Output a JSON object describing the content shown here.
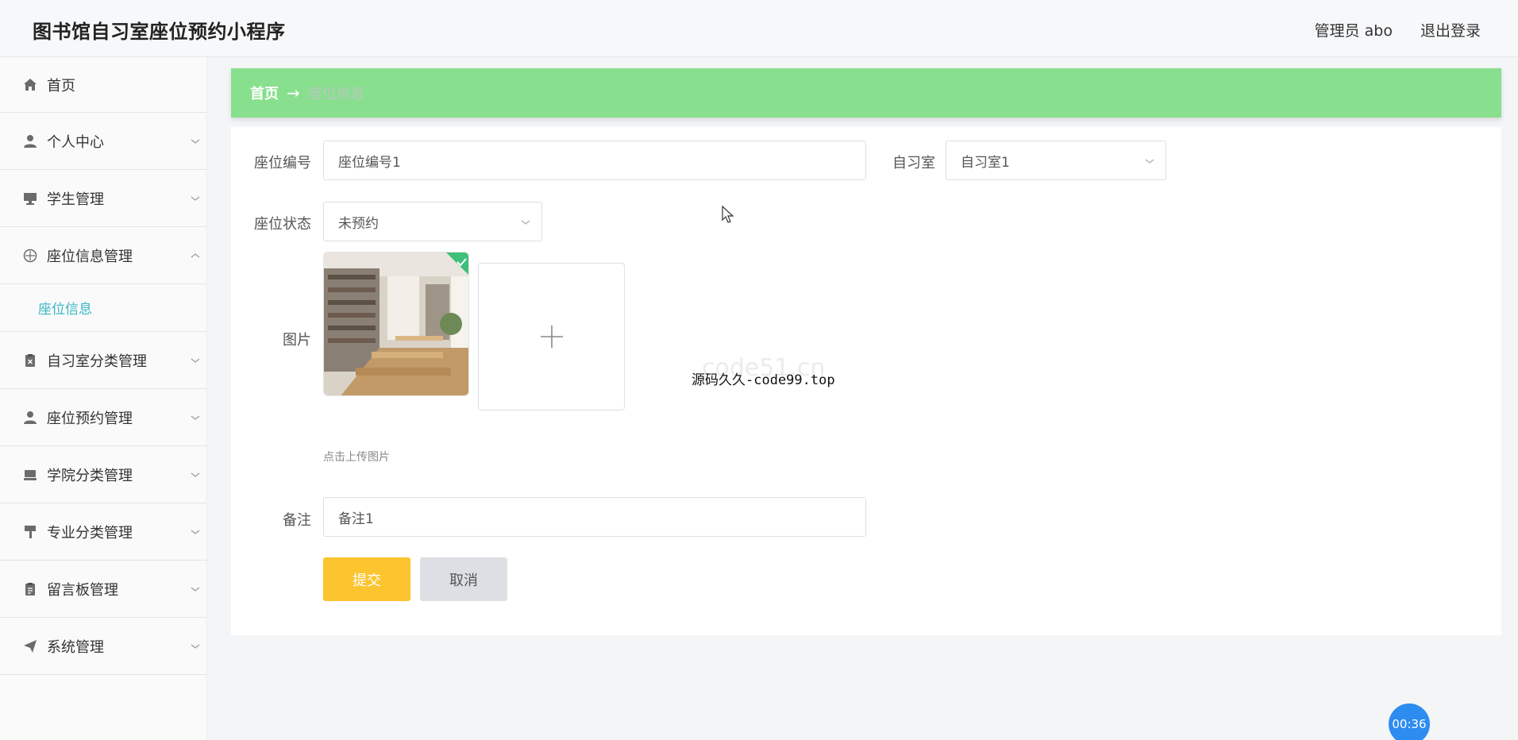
{
  "header": {
    "app_title": "图书馆自习室座位预约小程序",
    "admin_label": "管理员 abo",
    "logout": "退出登录"
  },
  "sidebar": {
    "items": [
      {
        "label": "首页",
        "icon": "home-icon"
      },
      {
        "label": "个人中心",
        "icon": "user-icon"
      },
      {
        "label": "学生管理",
        "icon": "monitor-icon"
      },
      {
        "label": "座位信息管理",
        "icon": "compass-icon",
        "expanded": true,
        "children": [
          {
            "label": "座位信息"
          }
        ]
      },
      {
        "label": "自习室分类管理",
        "icon": "clipboard-x-icon"
      },
      {
        "label": "座位预约管理",
        "icon": "user-icon"
      },
      {
        "label": "学院分类管理",
        "icon": "monitor-icon"
      },
      {
        "label": "专业分类管理",
        "icon": "paint-roller-icon"
      },
      {
        "label": "留言板管理",
        "icon": "clipboard-icon"
      },
      {
        "label": "系统管理",
        "icon": "send-icon"
      }
    ]
  },
  "breadcrumb": {
    "home": "首页",
    "arrow": "→",
    "current": "座位信息"
  },
  "form": {
    "seat_no_label": "座位编号",
    "seat_no_value": "座位编号1",
    "room_label": "自习室",
    "room_value": "自习室1",
    "status_label": "座位状态",
    "status_value": "未预约",
    "image_label": "图片",
    "upload_hint": "点击上传图片",
    "remark_label": "备注",
    "remark_value": "备注1",
    "submit": "提交",
    "cancel": "取消"
  },
  "watermark": {
    "background_text": "code51.cn",
    "overlay_text": "源码久久-code99.top"
  },
  "timer": "00:36",
  "colors": {
    "breadcrumb_bg": "#88df8d",
    "submit_bg": "#fcc42f",
    "cancel_bg": "#dcdfe3",
    "active_subnav": "#36b7c4",
    "timer_bg": "#2d8cf0"
  }
}
